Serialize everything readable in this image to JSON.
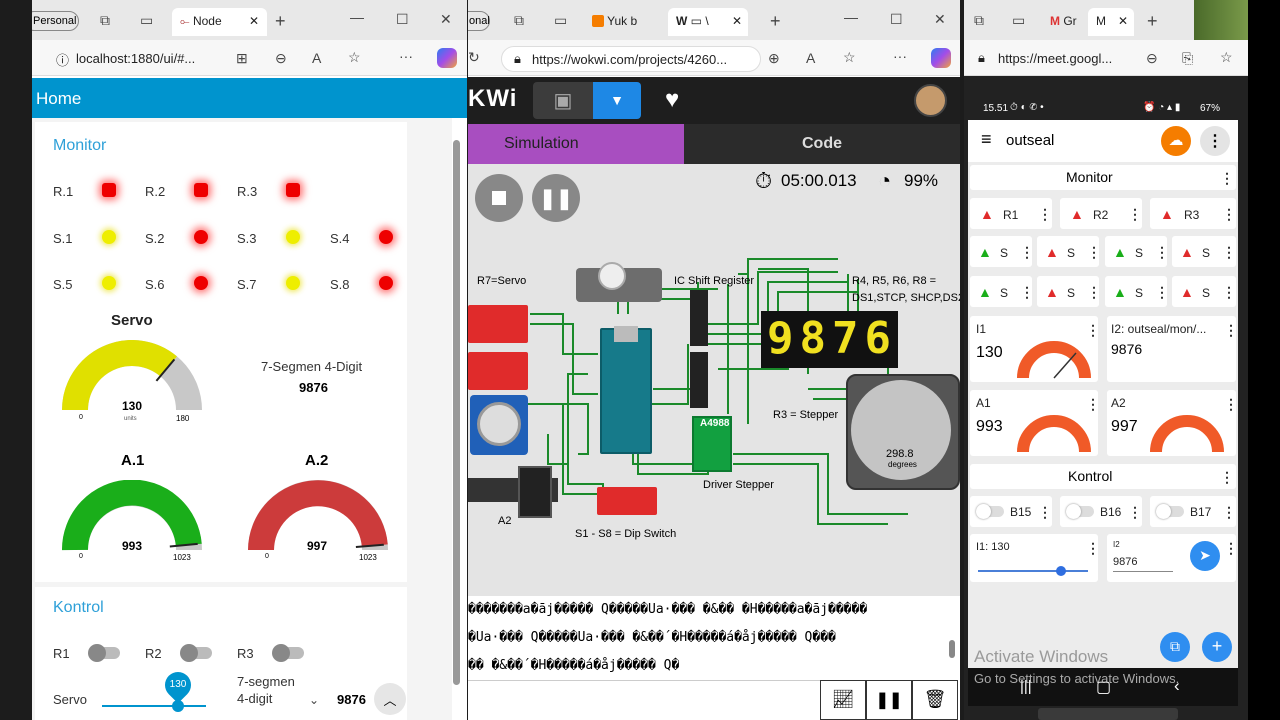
{
  "left": {
    "tab_profile": "Personal",
    "tab_title": "Node",
    "url": "localhost:1880/ui/#...",
    "header": "Home",
    "monitor_title": "Monitor",
    "relays": [
      "R.1",
      "R.2",
      "R.3"
    ],
    "switches": [
      "S.1",
      "S.2",
      "S.3",
      "S.4",
      "S.5",
      "S.6",
      "S.7",
      "S.8"
    ],
    "servo": {
      "title": "Servo",
      "value": "130",
      "units": "units",
      "min": "0",
      "max": "180",
      "level": 130
    },
    "seg_label": "7-Segmen 4-Digit",
    "seg_value": "9876",
    "a1": {
      "title": "A.1",
      "value": "993",
      "min": "0",
      "max": "1023",
      "level": 993
    },
    "a2": {
      "title": "A.2",
      "value": "997",
      "min": "0",
      "max": "1023",
      "level": 997
    },
    "kontrol_title": "Kontrol",
    "toggles": [
      "R1",
      "R2",
      "R3"
    ],
    "slider_label": "Servo",
    "slider_value": "130",
    "seg2_label": "7-segmen 4-digit",
    "seg2_value": "9876",
    "colors": {
      "header": "#0094ce",
      "title": "#2ea0d8",
      "green": "#1aae1a",
      "red": "#cc3b3b",
      "yellow": "#e0e000"
    }
  },
  "mid": {
    "tab_profile": "onal",
    "tab1": "Yuk b",
    "tab2": "\\",
    "url": "https://wokwi.com/projects/4260...",
    "logo": "KWi",
    "tab_sim": "Simulation",
    "tab_code": "Code",
    "timer": "05:00.013",
    "speed": "99%",
    "lbl_servo": "R7=Servo",
    "lbl_shift": "IC Shift Register",
    "lbl_r4": "R4, R5, R6, R8 =",
    "lbl_ds": "DS1,STCP, SHCP,DS2",
    "seg_display": "9876",
    "lbl_stepper": "R3 = Stepper",
    "stepper_value": "298.8",
    "stepper_units": "degrees",
    "lbl_a4988": "A4988",
    "lbl_driver": "Driver Stepper",
    "lbl_a2": "A2",
    "lbl_dip": "S1 - S8 = Dip Switch",
    "console": [
      "�������a�āj����� Q�����Ua·��� �&�� �H�����a�āj�����",
      "�Ua·��� Q�����Ua·��� �&��´�H�����á�åj����� Q���",
      "�� �&��´�H�����á�åj����� Q�"
    ]
  },
  "right": {
    "tab1": "Gr",
    "tab2": "M",
    "url": "https://meet.googl...",
    "status_time": "15.51",
    "battery": "67%",
    "app_title": "outseal",
    "monitor_title": "Monitor",
    "relays": [
      "R1",
      "R2",
      "R3"
    ],
    "s_short": "S",
    "i1_label": "I1",
    "i1_value": "130",
    "i2_label": "I2: outseal/mon/...",
    "i2_value": "9876",
    "a1_label": "A1",
    "a1_value": "993",
    "a2_label": "A2",
    "a2_value": "997",
    "kontrol_title": "Kontrol",
    "buttons": [
      "B15",
      "B16",
      "B17"
    ],
    "slider_label": "I1: 130",
    "i2_box_label": "I2",
    "i2_box_value": "9876",
    "watermark": "Activate Windows",
    "watermark_sub": "Go to Settings to activate Windows."
  }
}
